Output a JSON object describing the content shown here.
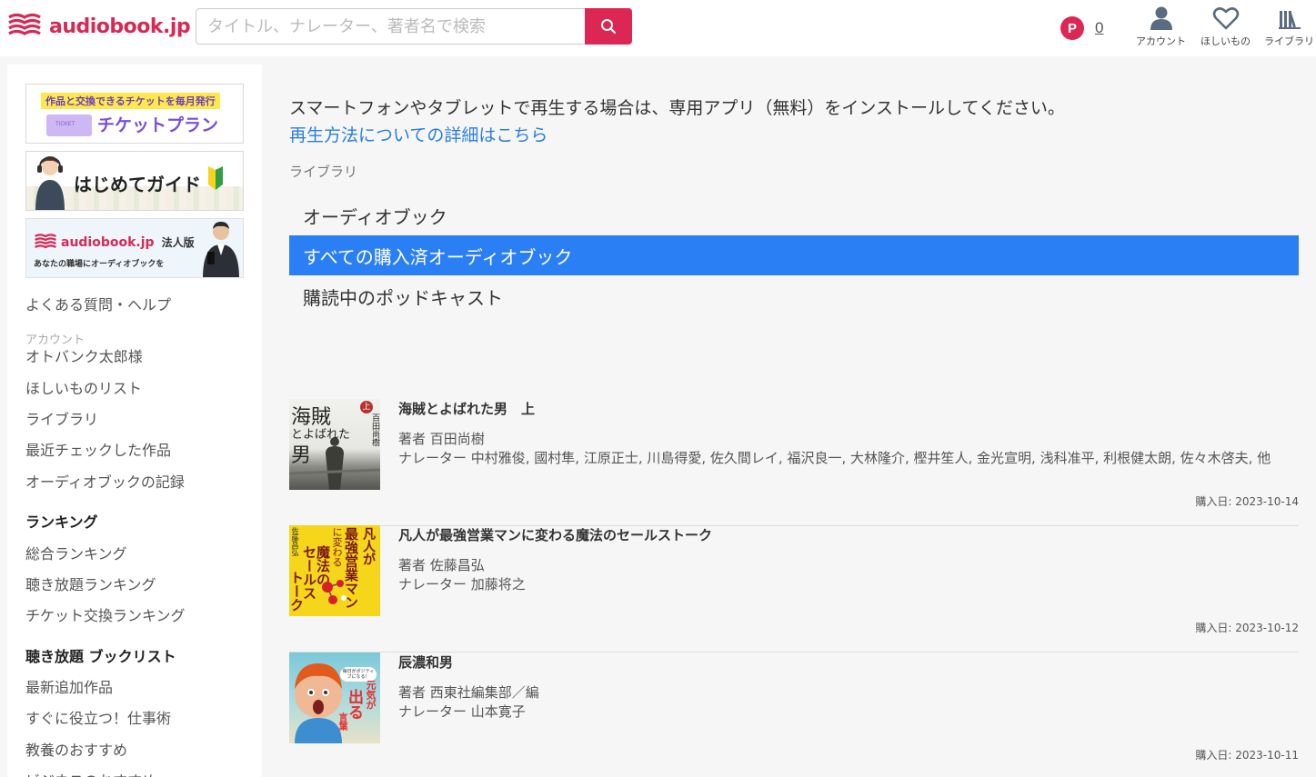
{
  "header": {
    "logo_text": "audiobook.jp",
    "search_placeholder": "タイトル、ナレーター、著者名で検索",
    "points_badge": "P",
    "points_count": "0",
    "nav": [
      {
        "label": "アカウント",
        "icon": "account-icon"
      },
      {
        "label": "ほしいもの",
        "icon": "heart-icon"
      },
      {
        "label": "ライブラリ",
        "icon": "library-icon"
      }
    ]
  },
  "sidebar": {
    "banners": [
      {
        "top_text": "作品と交換できるチケットを毎月発行",
        "main_text": "チケットプラン",
        "ticket_text": "TICKET"
      },
      {
        "main_text": "はじめてガイド"
      },
      {
        "brand_text": "audiobook.jp",
        "edition_text": "法人版",
        "sub_text": "あなたの職場にオーディオブックを"
      }
    ],
    "help_link": "よくある質問・ヘルプ",
    "account_label": "アカウント",
    "account_name": "オトバンク太郎様",
    "account_links": [
      "ほしいものリスト",
      "ライブラリ",
      "最近チェックした作品",
      "オーディオブックの記録"
    ],
    "ranking_heading": "ランキング",
    "ranking_links": [
      "総合ランキング",
      "聴き放題ランキング",
      "チケット交換ランキング"
    ],
    "booklist_heading": "聴き放題 ブックリスト",
    "booklist_links": [
      "最新追加作品",
      "すぐに役立つ！仕事術",
      "教養のおすすめ",
      "ビジネスのおすすめ"
    ]
  },
  "main": {
    "notice": "スマートフォンやタブレットで再生する場合は、専用アプリ（無料）をインストールしてください。",
    "notice_link": "再生方法についての詳細はこちら",
    "library_label": "ライブラリ",
    "tabs": [
      {
        "label": "オーディオブック",
        "active": false
      },
      {
        "label": "すべての購入済オーディオブック",
        "active": true
      },
      {
        "label": "購読中のポッドキャスト",
        "active": false
      }
    ],
    "items": [
      {
        "title": "海賊とよばれた男　上",
        "author": "著者 百田尚樹",
        "narrator": "ナレーター 中村雅俊, 國村隼, 江原正士, 川島得愛, 佐久間レイ, 福沢良一, 大林隆介, 樫井笙人, 金光宣明, 浅科准平, 利根健太朗, 佐々木啓夫, 他",
        "date": "購入日: 2023-10-14",
        "cover_text": [
          "海賊",
          "とよばれた",
          "男",
          "百田尚樹",
          "上"
        ]
      },
      {
        "title": "凡人が最強営業マンに変わる魔法のセールストーク",
        "author": "著者 佐藤昌弘",
        "narrator": "ナレーター 加藤将之",
        "date": "購入日: 2023-10-12",
        "cover_text": [
          "凡人が",
          "最強営業マン",
          "に変わる",
          "魔法の",
          "セールス",
          "トーク",
          "佐藤昌弘"
        ]
      },
      {
        "title": "辰濃和男",
        "author": "著者 西東社編集部／編",
        "narrator": "ナレーター 山本寛子",
        "date": "購入日: 2023-10-11",
        "cover_text": [
          "元気が",
          "出る",
          "言葉",
          "毎日がポジティブになる！"
        ]
      }
    ]
  },
  "colors": {
    "brand": "#dc2653",
    "active_tab": "#2a7ff5",
    "link": "#2a7ee0"
  }
}
